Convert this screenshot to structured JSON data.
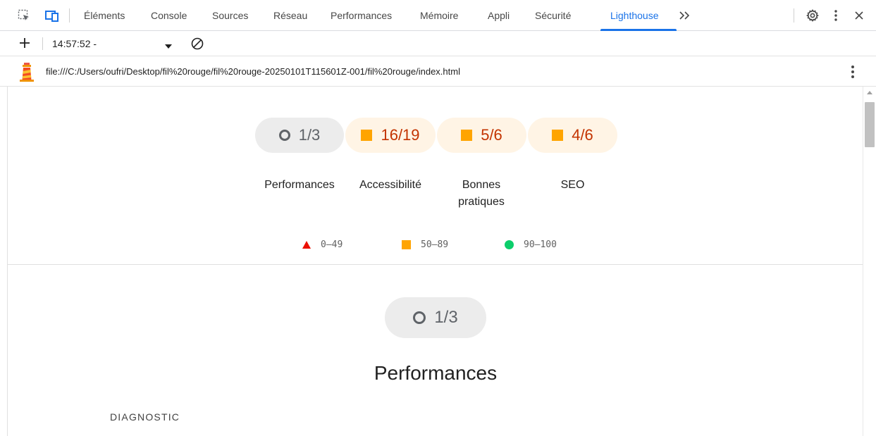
{
  "tabs": [
    {
      "label": "Éléments"
    },
    {
      "label": "Console"
    },
    {
      "label": "Sources"
    },
    {
      "label": "Réseau"
    },
    {
      "label": "Performances"
    },
    {
      "label": "Mémoire"
    },
    {
      "label": "Appli"
    },
    {
      "label": "Sécurité"
    },
    {
      "label": "Lighthouse",
      "active": true
    }
  ],
  "toolbar": {
    "timestamp": "14:57:52 -"
  },
  "report_url": "file:///C:/Users/oufri/Desktop/fil%20rouge/fil%20rouge-20250101T115601Z-001/fil%20rouge/index.html",
  "gauges": [
    {
      "score": "1/3",
      "label": "Performances",
      "rating": "neutral"
    },
    {
      "score": "16/19",
      "label": "Accessibilité",
      "rating": "average"
    },
    {
      "score": "5/6",
      "label": "Bonnes pratiques",
      "rating": "average"
    },
    {
      "score": "4/6",
      "label": "SEO",
      "rating": "average"
    }
  ],
  "legend": [
    {
      "range": "0–49",
      "shape": "triangle",
      "color": "#eb0f00"
    },
    {
      "range": "50–89",
      "shape": "square",
      "color": "#ffa400"
    },
    {
      "range": "90–100",
      "shape": "circle",
      "color": "#0cce6b"
    }
  ],
  "section": {
    "score": "1/3",
    "title": "Performances",
    "subheading": "DIAGNOSTIC"
  },
  "colors": {
    "accent": "#1a73e8",
    "fail": "#eb0f00",
    "average": "#ffa400",
    "pass": "#0cce6b"
  }
}
